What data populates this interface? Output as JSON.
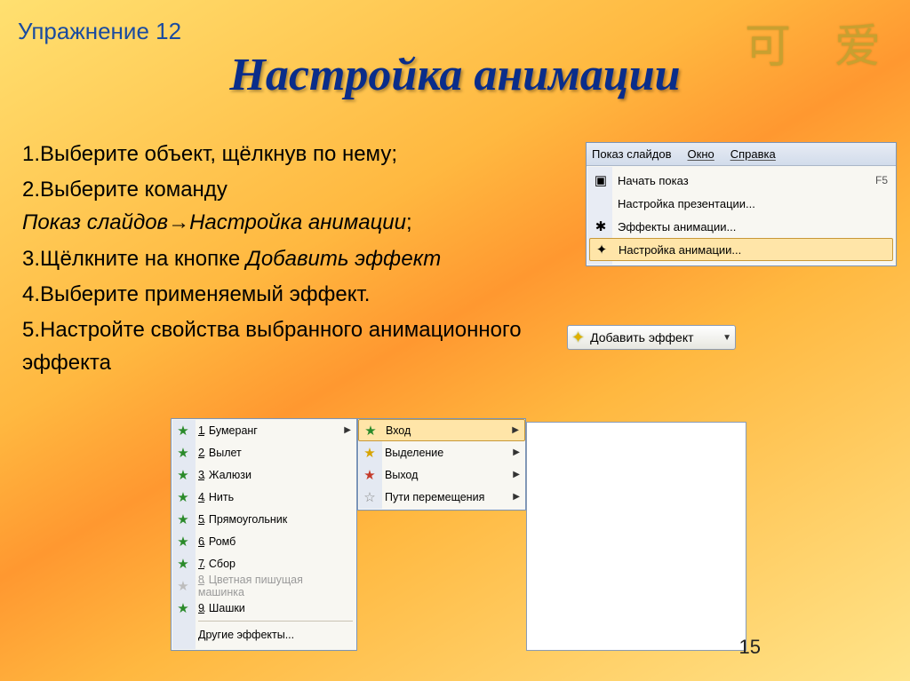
{
  "exercise_label": "Упражнение 12",
  "deco_chars": "可 爱",
  "slide_title": "Настройка анимации",
  "page_number": "15",
  "steps": {
    "s1": "1.Выберите объект, щёлкнув по нему;",
    "s2a": "2.Выберите команду",
    "s2b": "Показ слайдов→Настройка анимации",
    "s2c": ";",
    "s3a": "3.Щёлкните на кнопке ",
    "s3b": "Добавить эффект",
    "s4": "4.Выберите применяемый эффект.",
    "s5": "5.Настройте свойства выбранного анимационного эффекта"
  },
  "menu": {
    "bar": {
      "slideshow": "Показ слайдов",
      "window": "Окно",
      "help": "Справка"
    },
    "items": [
      {
        "icon": "▣",
        "label": "Начать показ",
        "shortcut": "F5"
      },
      {
        "icon": "",
        "label": "Настройка презентации...",
        "shortcut": ""
      },
      {
        "icon": "✱",
        "label": "Эффекты анимации...",
        "shortcut": ""
      },
      {
        "icon": "✦",
        "label": "Настройка анимации...",
        "shortcut": ""
      }
    ]
  },
  "add_effect_button": "Добавить эффект",
  "effects": {
    "list": [
      {
        "n": "1",
        "name": "Бумеранг"
      },
      {
        "n": "2",
        "name": "Вылет"
      },
      {
        "n": "3",
        "name": "Жалюзи"
      },
      {
        "n": "4",
        "name": "Нить"
      },
      {
        "n": "5",
        "name": "Прямоугольник"
      },
      {
        "n": "6",
        "name": "Ромб"
      },
      {
        "n": "7",
        "name": "Сбор"
      },
      {
        "n": "8",
        "name": "Цветная пишущая машинка"
      },
      {
        "n": "9",
        "name": "Шашки"
      }
    ],
    "other": "Другие эффекты..."
  },
  "categories": [
    {
      "name": "Вход",
      "color": "c-green"
    },
    {
      "name": "Выделение",
      "color": "c-yel"
    },
    {
      "name": "Выход",
      "color": "c-red"
    },
    {
      "name": "Пути перемещения",
      "color": "c-grey"
    }
  ]
}
